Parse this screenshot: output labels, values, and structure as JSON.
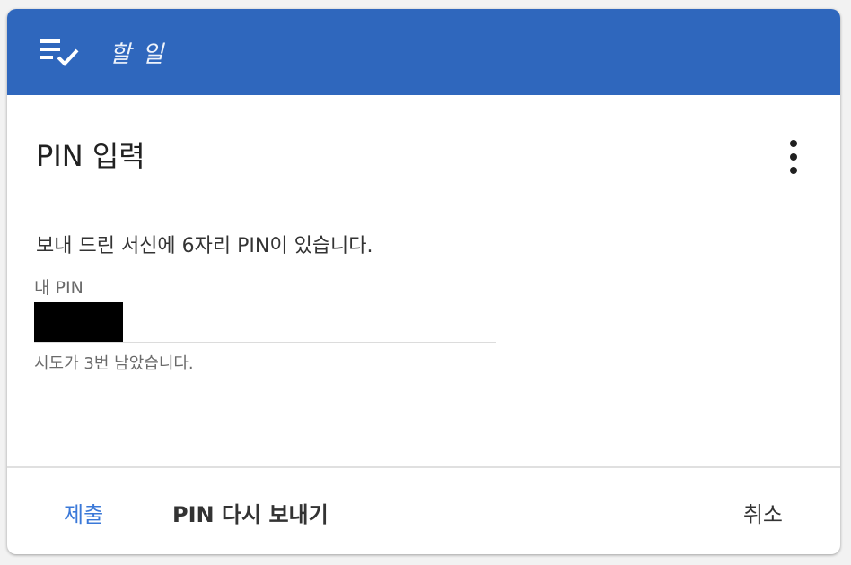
{
  "header": {
    "icon": "checklist-icon",
    "title": "할 일",
    "color": "#2f67bd"
  },
  "content": {
    "heading": "PIN 입력",
    "more_icon": "more-vert-icon",
    "message": "보내 드린 서신에 6자리 PIN이 있습니다.",
    "pin_field": {
      "label": "내 PIN",
      "value_redacted": true,
      "hint": "시도가 3번 남았습니다."
    }
  },
  "footer": {
    "submit_label": "제출",
    "resend_label": "PIN 다시 보내기",
    "cancel_label": "취소",
    "accent_color": "#3a78d8"
  }
}
